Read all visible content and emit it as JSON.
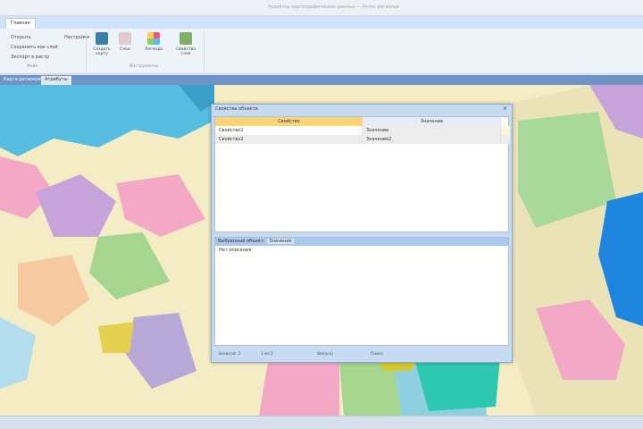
{
  "window": {
    "title": "Редактор картографических данных — Атлас регионов"
  },
  "ribbon": {
    "tab": "Главная",
    "left_items": [
      "Открыть",
      "Сохранить как слой",
      "Экспорт в растр"
    ],
    "extra_item": "Настройки",
    "buttons": [
      {
        "label": "Создать карту",
        "icon": "map-icon",
        "color": "#3c7fa8"
      },
      {
        "label": "Слои",
        "icon": "layers-icon",
        "color": "#e8c9c9"
      },
      {
        "label": "Легенда",
        "icon": "legend-icon",
        "color": "#9ec8e8"
      },
      {
        "label": "Свойства слоя",
        "icon": "properties-icon",
        "color": "#7fb06b"
      }
    ],
    "groups": [
      "Файл",
      "Инструменты"
    ]
  },
  "doc_tabs": [
    "Карта регионов",
    "Атрибуты"
  ],
  "dialog": {
    "title": "Свойства объекта",
    "columns": [
      "Свойство",
      "Значение"
    ],
    "rows": [
      [
        "Свойство1",
        "Значение"
      ],
      [
        "Свойство2",
        "Значение2"
      ]
    ],
    "lower_label": "Выбранный объект:",
    "lower_value": "Значение",
    "lower_text": "Нет описания",
    "toolbar": [
      "Записей: 2",
      "1 из 2",
      "Фильтр",
      "Поиск"
    ]
  },
  "colors": {
    "sea": "#56bde0",
    "land": "#f4ecc4",
    "accent": "#fbd47a"
  }
}
